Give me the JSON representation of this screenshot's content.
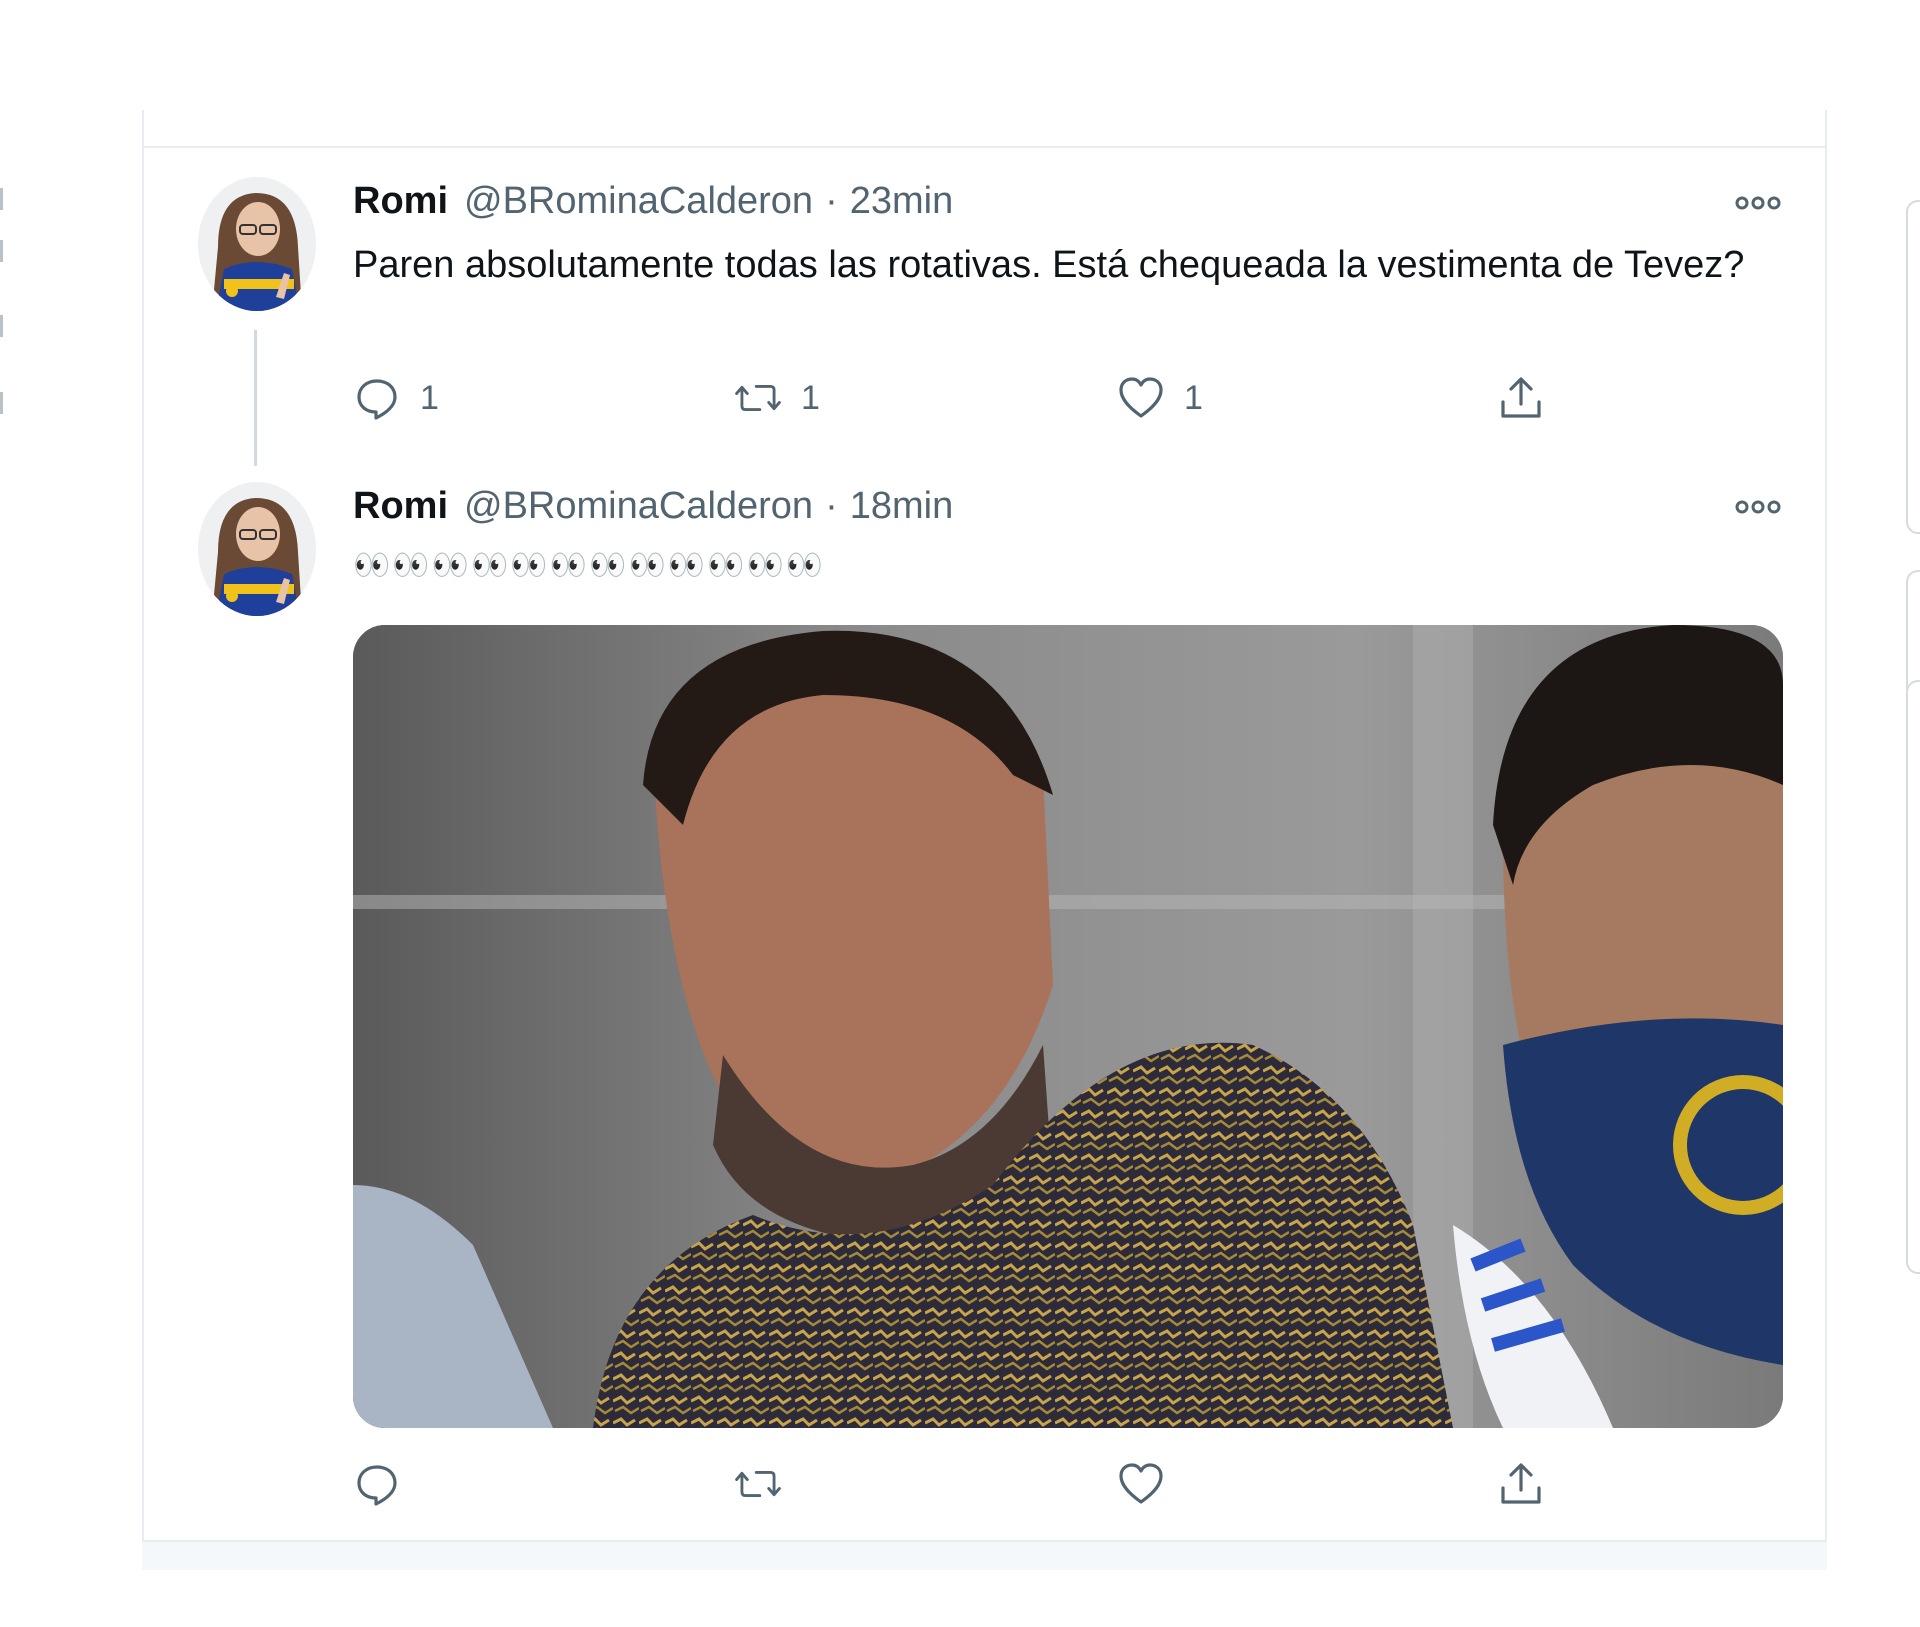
{
  "timeline": {
    "tweets": [
      {
        "name": "Romi",
        "handle": "@BRominaCalderon",
        "separator": "·",
        "time": "23min",
        "text": "Paren absolutamente todas las rotativas. Está chequeada la vestimenta de Tevez?",
        "more_icon": "more-dots-icon",
        "actions": {
          "reply_count": "1",
          "retweet_count": "1",
          "like_count": "1"
        }
      },
      {
        "name": "Romi",
        "handle": "@BRominaCalderon",
        "separator": "·",
        "time": "18min",
        "text": "👀👀👀👀👀👀👀👀👀👀👀👀",
        "more_icon": "more-dots-icon",
        "media": "photo",
        "actions": {
          "reply_count": "",
          "retweet_count": "",
          "like_count": ""
        }
      }
    ]
  },
  "icons": [
    "reply-icon",
    "retweet-icon",
    "like-icon",
    "share-icon",
    "more-dots-icon"
  ],
  "colors": {
    "text_primary": "#0f1419",
    "text_secondary": "#536471",
    "border": "#e7ecf0",
    "thread_line": "#cfd9de"
  }
}
